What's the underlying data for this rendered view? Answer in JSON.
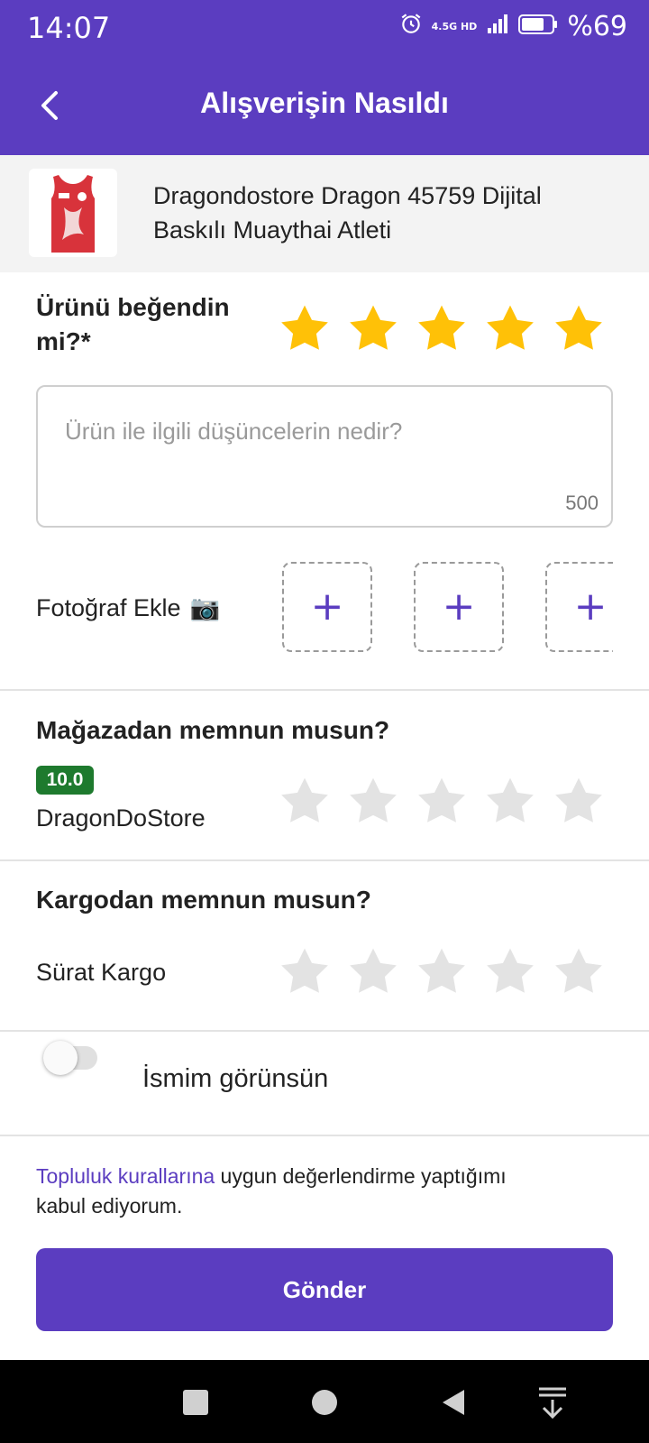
{
  "status_bar": {
    "time": "14:07",
    "network": "4.5G HD",
    "battery": "%69"
  },
  "header": {
    "title": "Alışverişin Nasıldı"
  },
  "product": {
    "name_line1": "Dragondostore Dragon 45759 Dijital",
    "name_line2": "Baskılı Muaythai Atleti"
  },
  "product_rating": {
    "question_line1": "Ürünü beğendin",
    "question_line2": "mi?*",
    "stars": 5,
    "max": 5,
    "filled_color": "#FFC107",
    "empty_color": "#E3E3E3"
  },
  "comment": {
    "placeholder": "Ürün ile ilgili düşüncelerin nedir?",
    "char_count": "500"
  },
  "photos": {
    "label": "Fotoğraf Ekle",
    "camera_icon": "📷",
    "add_symbol": "+"
  },
  "store_rating": {
    "question": "Mağazadan memnun musun?",
    "score": "10.0",
    "store_name": "DragonDoStore",
    "stars": 0,
    "max": 5
  },
  "cargo_rating": {
    "question": "Kargodan memnun musun?",
    "cargo_name": "Sürat Kargo",
    "stars": 0,
    "max": 5
  },
  "show_name": {
    "label": "İsmim görünsün",
    "on": false
  },
  "terms": {
    "link_text": "Topluluk kurallarına",
    "rest_line1": " uygun değerlendirme yaptığımı",
    "rest_line2": "kabul ediyorum."
  },
  "submit": {
    "label": "Gönder"
  },
  "colors": {
    "brand": "#5B3DC0",
    "badge": "#1E7A2E"
  }
}
